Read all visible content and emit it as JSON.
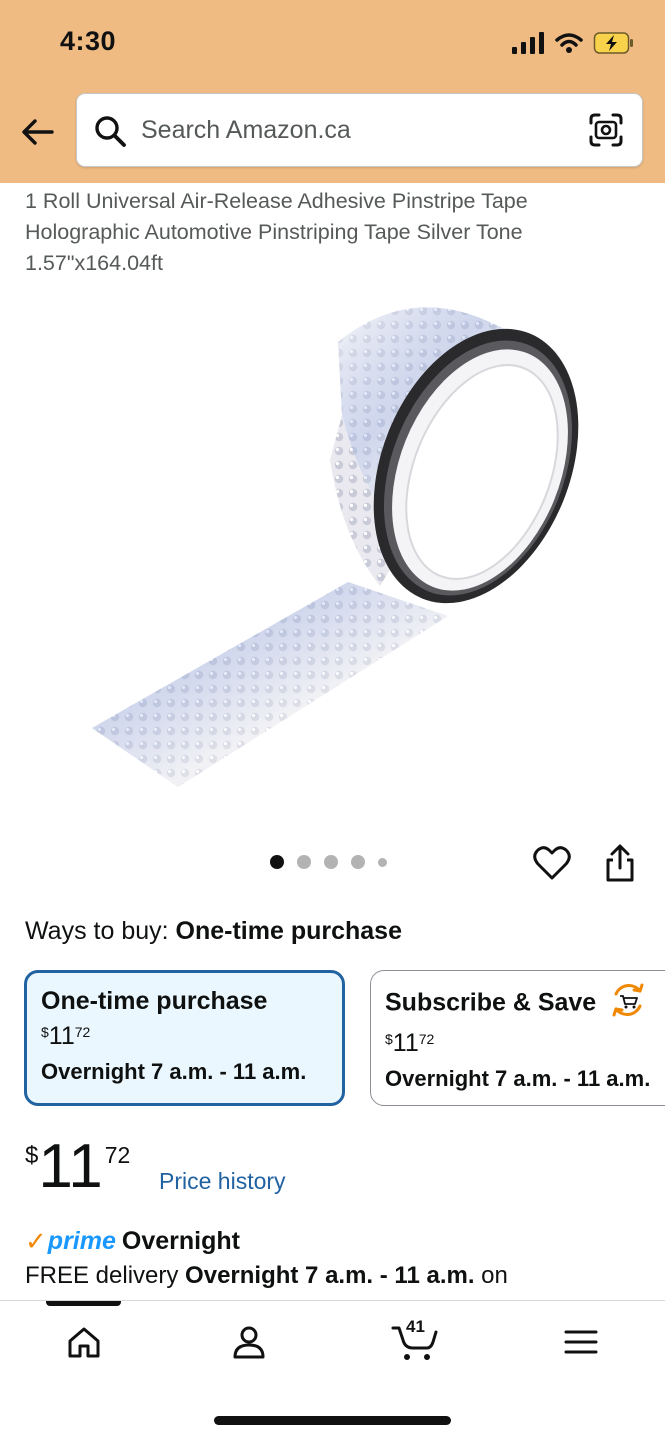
{
  "status_bar": {
    "time": "4:30",
    "icons": [
      "cellular-signal-icon",
      "wifi-icon",
      "battery-charging-icon"
    ]
  },
  "header": {
    "back_icon": "back-arrow-icon",
    "search": {
      "placeholder": "Search Amazon.ca",
      "value": "",
      "left_icon": "search-icon",
      "right_icon": "camera-lens-icon"
    }
  },
  "product": {
    "title": "1 Roll Universal Air-Release Adhesive Pinstripe Tape Holographic Automotive Pinstriping Tape Silver Tone 1.57\"x164.04ft",
    "image_alt": "holographic silver pinstripe tape roll",
    "gallery": {
      "count": 5,
      "active_index": 0
    },
    "actions": [
      "heart-icon",
      "share-icon"
    ]
  },
  "ways_to_buy": {
    "label": "Ways to buy:",
    "selected": "One-time purchase",
    "options": [
      {
        "title": "One-time purchase",
        "currency": "$",
        "dollars": "11",
        "cents": "72",
        "delivery": "Overnight 7 a.m. - 11 a.m.",
        "selected": true
      },
      {
        "title": "Subscribe & Save",
        "icon": "subscribe-save-cart-icon",
        "currency": "$",
        "dollars": "11",
        "cents": "72",
        "delivery": "Overnight 7 a.m. - 11 a.m.",
        "selected": false
      }
    ]
  },
  "price": {
    "currency": "$",
    "dollars": "11",
    "cents": "72",
    "history_link": "Price history"
  },
  "delivery": {
    "prime_check": "✓",
    "prime_label": "prime",
    "prime_speed": "Overnight",
    "free_prefix": "FREE delivery",
    "free_window": "Overnight 7 a.m. - 11 a.m.",
    "free_suffix": "on"
  },
  "bottom_nav": {
    "items": [
      "home-icon",
      "account-icon",
      "cart-icon",
      "menu-icon"
    ],
    "active_index": 0,
    "cart_count": "41"
  },
  "colors": {
    "header_bg": "#efbb83",
    "link_blue": "#2162a1",
    "selected_card_bg": "#eaf7fe",
    "prime_blue": "#1a98ff",
    "prime_orange": "#f08804"
  }
}
